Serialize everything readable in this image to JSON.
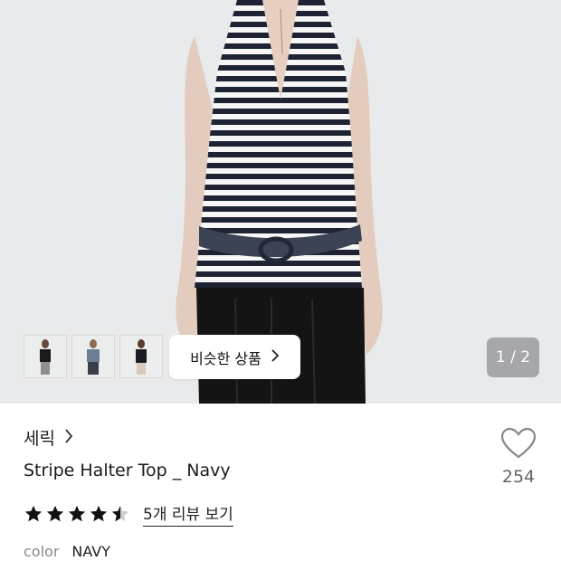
{
  "gallery": {
    "similar_button_label": "비슷한 상품",
    "pager_text": "1 / 2",
    "thumbnails": [
      "thumbnail-1",
      "thumbnail-2",
      "thumbnail-3"
    ]
  },
  "product": {
    "brand": "세릭",
    "name": "Stripe Halter Top _ Navy",
    "like_count": "254",
    "rating": 4.5,
    "review_link": "5개 리뷰 보기",
    "color_label": "color",
    "color_value": "NAVY"
  },
  "colors": {
    "background": "#e9eaec",
    "stripe_navy": "#1d2333",
    "star": "#111111"
  },
  "icons": {
    "like": "heart-outline-icon",
    "brand_chevron": "chevron-right-icon",
    "similar_chevron": "chevron-right-icon"
  }
}
